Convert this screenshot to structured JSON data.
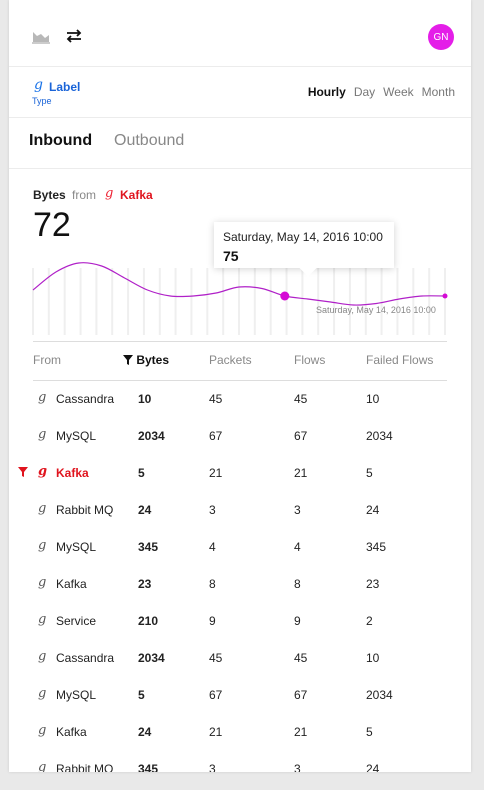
{
  "header": {
    "avatar_initials": "GN"
  },
  "label_row": {
    "label": "Label",
    "type": "Type",
    "time_tabs": [
      "Hourly",
      "Day",
      "Week",
      "Month"
    ],
    "active_time_tab": "Hourly"
  },
  "direction_tabs": [
    "Inbound",
    "Outbound"
  ],
  "active_direction": "Inbound",
  "metric": {
    "title": "Bytes",
    "from_word": "from",
    "source": "Kafka",
    "value": "72"
  },
  "tooltip": {
    "date": "Saturday, May 14, 2016 10:00",
    "value": "75"
  },
  "chart_data": {
    "type": "line",
    "x_label": "Saturday, May 14, 2016 10:00",
    "values": [
      70,
      82,
      88,
      86,
      78,
      70,
      66,
      66,
      68,
      72,
      71,
      66,
      64,
      62,
      60,
      61,
      64,
      66,
      66
    ],
    "highlight_index": 11,
    "colors": {
      "line": "#b020c8",
      "point": "#d50ad5"
    }
  },
  "table": {
    "columns": [
      "From",
      "Bytes",
      "Packets",
      "Flows",
      "Failed Flows"
    ],
    "rows": [
      {
        "name": "Cassandra",
        "bytes": "10",
        "packets": "45",
        "flows": "45",
        "failed": "10"
      },
      {
        "name": "MySQL",
        "bytes": "2034",
        "packets": "67",
        "flows": "67",
        "failed": "2034"
      },
      {
        "name": "Kafka",
        "bytes": "5",
        "packets": "21",
        "flows": "21",
        "failed": "5",
        "selected": true
      },
      {
        "name": "Rabbit MQ",
        "bytes": "24",
        "packets": "3",
        "flows": "3",
        "failed": "24"
      },
      {
        "name": "MySQL",
        "bytes": "345",
        "packets": "4",
        "flows": "4",
        "failed": "345"
      },
      {
        "name": "Kafka",
        "bytes": "23",
        "packets": "8",
        "flows": "8",
        "failed": "23"
      },
      {
        "name": "Service",
        "bytes": "210",
        "packets": "9",
        "flows": "9",
        "failed": "2"
      },
      {
        "name": "Cassandra",
        "bytes": "2034",
        "packets": "45",
        "flows": "45",
        "failed": "10"
      },
      {
        "name": "MySQL",
        "bytes": "5",
        "packets": "67",
        "flows": "67",
        "failed": "2034"
      },
      {
        "name": "Kafka",
        "bytes": "24",
        "packets": "21",
        "flows": "21",
        "failed": "5"
      },
      {
        "name": "Rabbit MQ",
        "bytes": "345",
        "packets": "3",
        "flows": "3",
        "failed": "24"
      }
    ]
  },
  "colors": {
    "accent_red": "#e0141e",
    "accent_blue": "#1a64d8",
    "avatar": "#e41ee8"
  }
}
